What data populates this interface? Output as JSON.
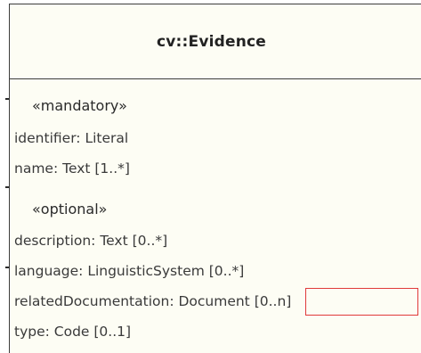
{
  "class": {
    "name": "cv::Evidence"
  },
  "mandatory": {
    "stereotype": "«mandatory»",
    "attributes": [
      "identifier: Literal",
      "name: Text [1..*]"
    ]
  },
  "optional": {
    "stereotype": "«optional»",
    "attributes": [
      "description: Text [0..*]",
      "language: LinguisticSystem [0..*]",
      "relatedDocumentation: Document [0..n]",
      "type: Code [0..1]"
    ]
  },
  "colors": {
    "class_fill": "#fdfdf4",
    "border": "#3c3c3c",
    "highlight": "#e03a3a"
  }
}
